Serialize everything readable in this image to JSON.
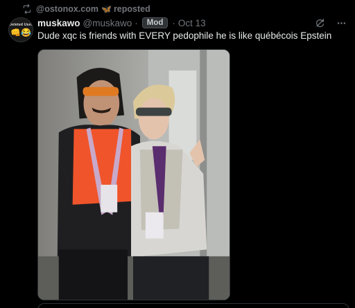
{
  "repost": {
    "icon": "repost-icon",
    "user": "@ostonox.com",
    "emoji": "🦋",
    "label": "reposted"
  },
  "post": {
    "avatar": {
      "label": "Deleted User",
      "emoji": "👊😂"
    },
    "display_name": "muskawo",
    "handle": "@muskawo",
    "separator": "·",
    "badge": "Mod",
    "timestamp": "Oct 13",
    "text": "Dude xqc is friends with EVERY pedophile he is like québécois Epstein",
    "actions": [
      "refresh-icon",
      "more-icon"
    ],
    "media": {
      "description_icon": "photo-image",
      "colors": {
        "orange_vest": "#f0542b",
        "hoodie": "#d8d6d2",
        "wall": "#9b9c98"
      }
    }
  }
}
